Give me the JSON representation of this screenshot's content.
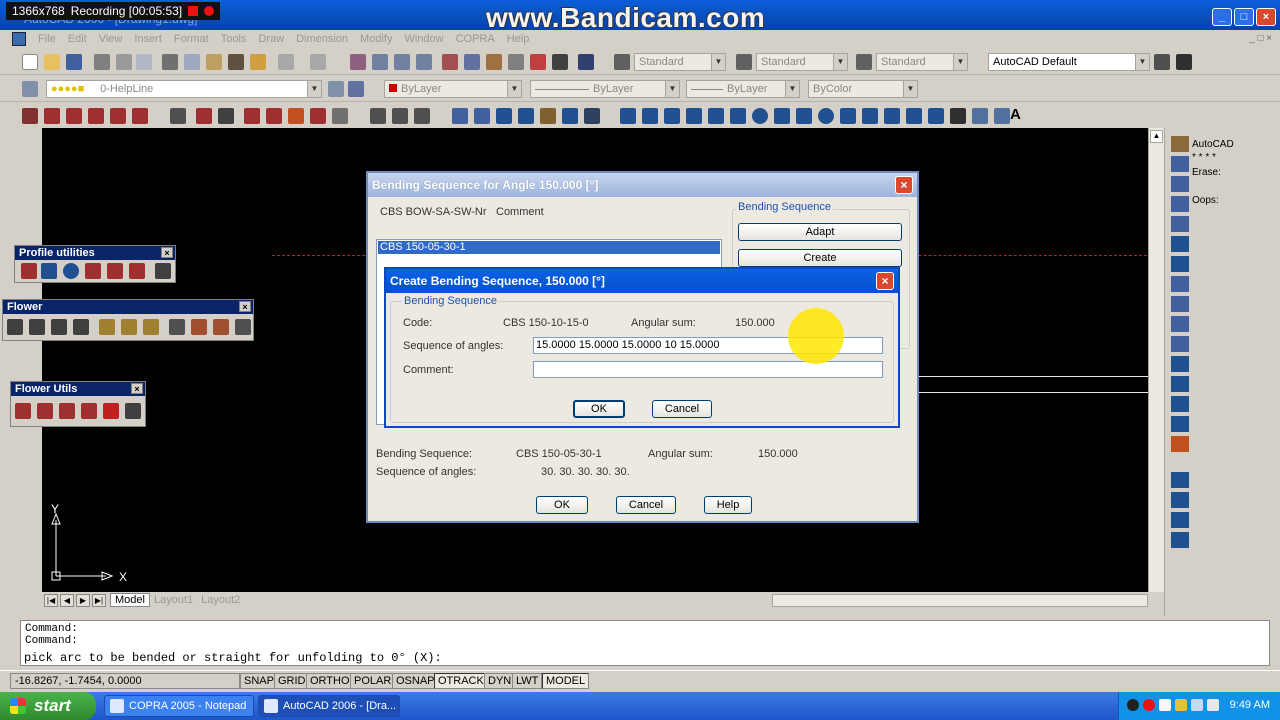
{
  "recorder": {
    "resolution": "1366x768",
    "status": "Recording [00:05:53]"
  },
  "watermark": "www.Bandicam.com",
  "app_title": "AutoCAD 2006 - [Drawing1.dwg]",
  "menu": [
    "File",
    "Edit",
    "View",
    "Insert",
    "Format",
    "Tools",
    "Draw",
    "Dimension",
    "Modify",
    "Window",
    "COPRA",
    "Help"
  ],
  "toolbar": {
    "text_style": "Standard",
    "dim_style": "Standard",
    "table_style": "Standard",
    "workspace": "AutoCAD Default",
    "layer": "0-HelpLine",
    "color": "ByLayer",
    "linetype": "ByLayer",
    "lineweight": "ByLayer",
    "plotstyle": "ByColor"
  },
  "floating_toolbars": {
    "profile": "Profile utilities",
    "flower": "Flower",
    "flower_utils": "Flower Utils"
  },
  "axes": {
    "y": "Y",
    "x": "X"
  },
  "right_panel": [
    "AutoCAD",
    "* * * *",
    "Erase:",
    "Oops:"
  ],
  "outer_dialog": {
    "title": "Bending Sequence for Angle  150.000 [°]",
    "col_code": "CBS BOW-SA-SW-Nr",
    "col_comment": "Comment",
    "list_item": "CBS 150-05-30-1",
    "group_title": "Bending Sequence",
    "adapt": "Adapt",
    "create": "Create",
    "bending_seq_label": "Bending Sequence:",
    "bending_seq_value": "CBS 150-05-30-1",
    "angular_sum_label": "Angular sum:",
    "angular_sum_value": "150.000",
    "seq_angles_label": "Sequence of angles:",
    "seq_angles_value": "30. 30. 30. 30. 30.",
    "ok": "OK",
    "cancel": "Cancel",
    "help": "Help"
  },
  "inner_dialog": {
    "title": "Create Bending Sequence,  150.000 [°]",
    "group_title": "Bending Sequence",
    "code_label": "Code:",
    "code_value": "CBS 150-10-15-0",
    "angular_sum_label": "Angular sum:",
    "angular_sum_value": "150.000",
    "seq_label": "Sequence of angles:",
    "seq_value": "15.0000 15.0000 15.0000 10 15.0000",
    "comment_label": "Comment:",
    "comment_value": "",
    "ok": "OK",
    "cancel": "Cancel"
  },
  "tabs": [
    "Model",
    "Layout1",
    "Layout2"
  ],
  "command": {
    "line1": "Command:",
    "line2": "Command:",
    "prompt": "pick arc to be bended or straight for unfolding to 0° (X):"
  },
  "status": {
    "coords": "-16.8267, -1.7454, 0.0000",
    "buttons": [
      "SNAP",
      "GRID",
      "ORTHO",
      "POLAR",
      "OSNAP",
      "OTRACK",
      "DYN",
      "LWT",
      "MODEL"
    ]
  },
  "taskbar": {
    "start": "start",
    "items": [
      "COPRA 2005 - Notepad",
      "AutoCAD 2006 - [Dra..."
    ],
    "clock": "9:49 AM"
  }
}
